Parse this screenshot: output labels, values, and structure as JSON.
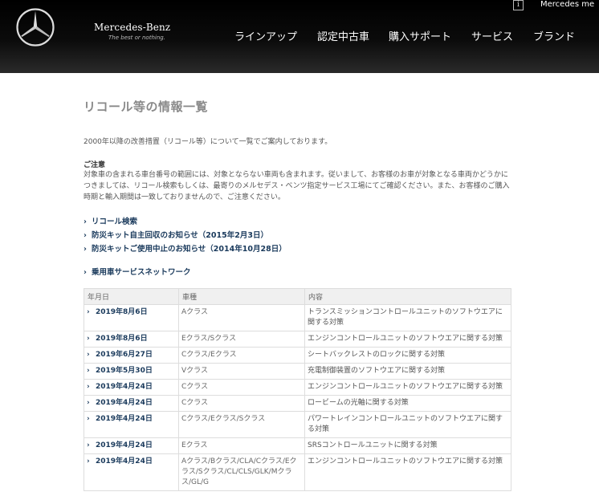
{
  "header": {
    "brand_name": "Mercedes-Benz",
    "brand_tagline": "The best or nothing.",
    "util_info_icon": "i",
    "util_mercedes_me": "Mercedes me",
    "nav": [
      "ラインアップ",
      "認定中古車",
      "購入サポート",
      "サービス",
      "ブランド"
    ]
  },
  "page": {
    "title": "リコール等の情報一覧",
    "intro": "2000年以降の改善措置（リコール等）について一覧でご案内しております。",
    "note_heading": "ご注意",
    "note_body": "対象車の含まれる車台番号の範囲には、対象とならない車両も含まれます。従いまして、お客様のお車が対象となる車両かどうかにつきましては、リコール検索もしくは、最寄りのメルセデス・ベンツ指定サービス工場にてご確認ください。また、お客様のご購入時期と輸入期間は一致しておりませんので、ご注意ください。",
    "links": [
      "リコール検索",
      "防災キット自主回収のお知らせ（2015年2月3日）",
      "防災キットご使用中止のお知らせ（2014年10月28日）"
    ],
    "network_link": "乗用車サービスネットワーク"
  },
  "table": {
    "headers": [
      "年月日",
      "車種",
      "内容"
    ],
    "rows": [
      {
        "date": "2019年8月6日",
        "model": "Aクラス",
        "desc": "トランスミッションコントロールユニットのソフトウエアに関する対策"
      },
      {
        "date": "2019年8月6日",
        "model": "Eクラス/Sクラス",
        "desc": "エンジンコントロールユニットのソフトウエアに関する対策"
      },
      {
        "date": "2019年6月27日",
        "model": "Cクラス/Eクラス",
        "desc": "シートバックレストのロックに関する対策"
      },
      {
        "date": "2019年5月30日",
        "model": "Vクラス",
        "desc": "充電制御装置のソフトウエアに関する対策"
      },
      {
        "date": "2019年4月24日",
        "model": "Cクラス",
        "desc": "エンジンコントロールユニットのソフトウエアに関する対策"
      },
      {
        "date": "2019年4月24日",
        "model": "Cクラス",
        "desc": "ロービームの光軸に関する対策"
      },
      {
        "date": "2019年4月24日",
        "model": "Cクラス/Eクラス/Sクラス",
        "desc": "パワートレインコントロールユニットのソフトウエアに関する対策"
      },
      {
        "date": "2019年4月24日",
        "model": "Eクラス",
        "desc": "SRSコントロールユニットに関する対策"
      },
      {
        "date": "2019年4月24日",
        "model": "Aクラス/Bクラス/CLA/Cクラス/Eクラス/Sクラス/CL/CLS/GLK/Mクラス/GL/G",
        "desc": "エンジンコントロールユニットのソフトウエアに関する対策"
      }
    ]
  }
}
